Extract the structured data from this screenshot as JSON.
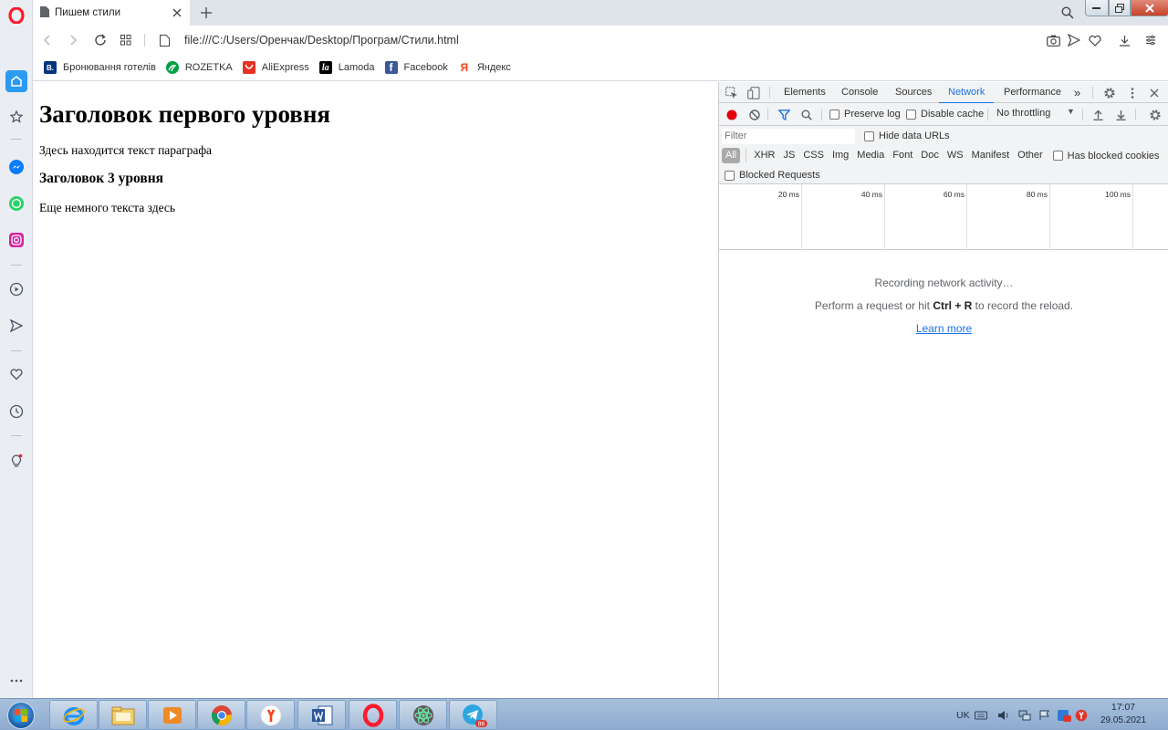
{
  "browser": {
    "tab": {
      "title": "Пишем стили"
    },
    "url": "file:///C:/Users/Оренчак/Desktop/Програм/Стили.html",
    "bookmarks": [
      {
        "label": "Бронювання готелів",
        "icon": "booking-icon",
        "color": "#003580",
        "glyph": "B."
      },
      {
        "label": "ROZETKA",
        "icon": "rozetka-icon",
        "color": "#00a046",
        "glyph": ""
      },
      {
        "label": "AliExpress",
        "icon": "aliexpress-icon",
        "color": "#e43225",
        "glyph": ""
      },
      {
        "label": "Lamoda",
        "icon": "lamoda-icon",
        "color": "#000000",
        "glyph": "la"
      },
      {
        "label": "Facebook",
        "icon": "facebook-icon",
        "color": "#3b5998",
        "glyph": "f"
      },
      {
        "label": "Яндекс",
        "icon": "yandex-icon",
        "color": "#ffffff",
        "glyph": "Я"
      }
    ]
  },
  "page": {
    "h1": "Заголовок первого уровня",
    "p1": "Здесь находится текст параграфа",
    "h3": "Заголовок 3 уровня",
    "p2": "Еще немного текста здесь"
  },
  "devtools": {
    "tabs": [
      "Elements",
      "Console",
      "Sources",
      "Network",
      "Performance"
    ],
    "active_tab": "Network",
    "more": "»",
    "toolbar": {
      "preserve_log": "Preserve log",
      "disable_cache": "Disable cache",
      "throttling": "No throttling"
    },
    "filter": {
      "placeholder": "Filter",
      "hide_data_urls": "Hide data URLs",
      "types": [
        "All",
        "XHR",
        "JS",
        "CSS",
        "Img",
        "Media",
        "Font",
        "Doc",
        "WS",
        "Manifest",
        "Other"
      ],
      "has_blocked_cookies": "Has blocked cookies",
      "blocked_requests": "Blocked Requests"
    },
    "timeline": [
      "20 ms",
      "40 ms",
      "60 ms",
      "80 ms",
      "100 ms"
    ],
    "empty": {
      "line1": "Recording network activity…",
      "line2_pre": "Perform a request or hit ",
      "line2_key": "Ctrl + R",
      "line2_post": " to record the reload.",
      "link": "Learn more"
    }
  },
  "taskbar": {
    "lang": "UK",
    "time": "17:07",
    "date": "29.05.2021",
    "telegram_badge": "86"
  },
  "colors": {
    "opera_red": "#ff1b2d",
    "devtools_blue": "#1a73e8",
    "record_red": "#e6000b"
  }
}
